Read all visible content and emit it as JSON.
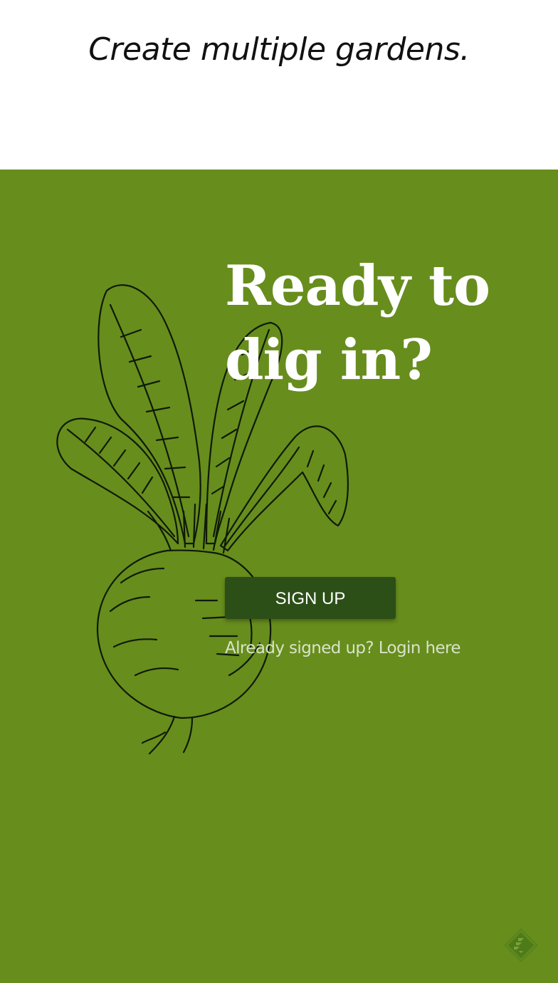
{
  "features": {
    "caption": "Create multiple gardens."
  },
  "cta": {
    "heading_line1": "Ready to",
    "heading_line2": "dig in?",
    "signup_label": "SIGN UP",
    "login_text": "Already signed up? Login here"
  },
  "illustration": {
    "icon": "beet-illustration"
  },
  "badge": {
    "icon": "feedly-icon"
  },
  "colors": {
    "cta_background": "#678d1d",
    "signup_button": "#2c4f18",
    "heading": "#ffffff",
    "login_link": "#d9e3c9"
  }
}
